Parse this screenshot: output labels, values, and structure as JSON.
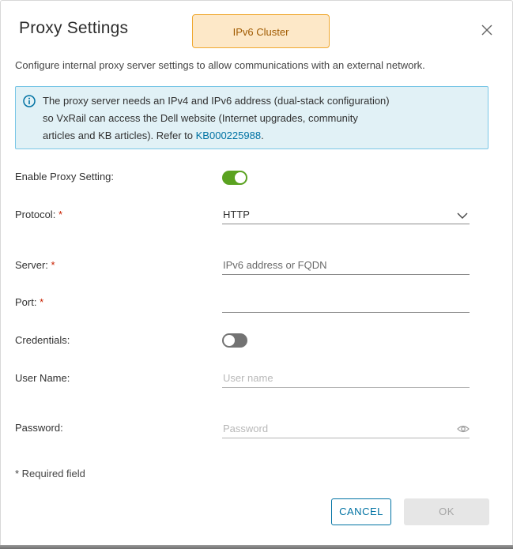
{
  "dialog": {
    "title": "Proxy Settings",
    "cluster_tag": "IPv6 Cluster",
    "description": "Configure internal proxy server settings to allow communications with an external network."
  },
  "info": {
    "line1": "The proxy server needs an IPv4 and IPv6 address (dual-stack configuration)",
    "line2": "so VxRail can access the Dell website (Internet upgrades, community",
    "line3_prefix": "articles  and KB articles).  Refer to ",
    "link_text": "KB000225988",
    "line3_suffix": "."
  },
  "form": {
    "enable_proxy_label": "Enable Proxy Setting:",
    "enable_proxy_on": true,
    "protocol_label": "Protocol:",
    "protocol_value": "HTTP",
    "server_label": "Server:",
    "server_placeholder": "IPv6 address or FQDN",
    "port_label": "Port:",
    "port_value": "",
    "credentials_label": "Credentials:",
    "credentials_on": false,
    "username_label": "User Name:",
    "username_placeholder": "User name",
    "password_label": "Password:",
    "password_placeholder": "Password",
    "required_marker": "*",
    "required_note": "* Required field"
  },
  "buttons": {
    "cancel": "CANCEL",
    "ok": "OK"
  },
  "colors": {
    "accent": "#0072a3",
    "toggle_on": "#5aa220",
    "toggle_off": "#737373",
    "required": "#c92100",
    "cluster_tag_bg": "#fde8c8",
    "cluster_tag_border": "#f0a830",
    "info_bg": "#e1f1f6",
    "info_border": "#79c6e6"
  },
  "icons": {
    "close": "close-icon",
    "info": "info-circle-icon",
    "dropdown": "chevron-down-icon",
    "password_reveal": "eye-icon"
  }
}
